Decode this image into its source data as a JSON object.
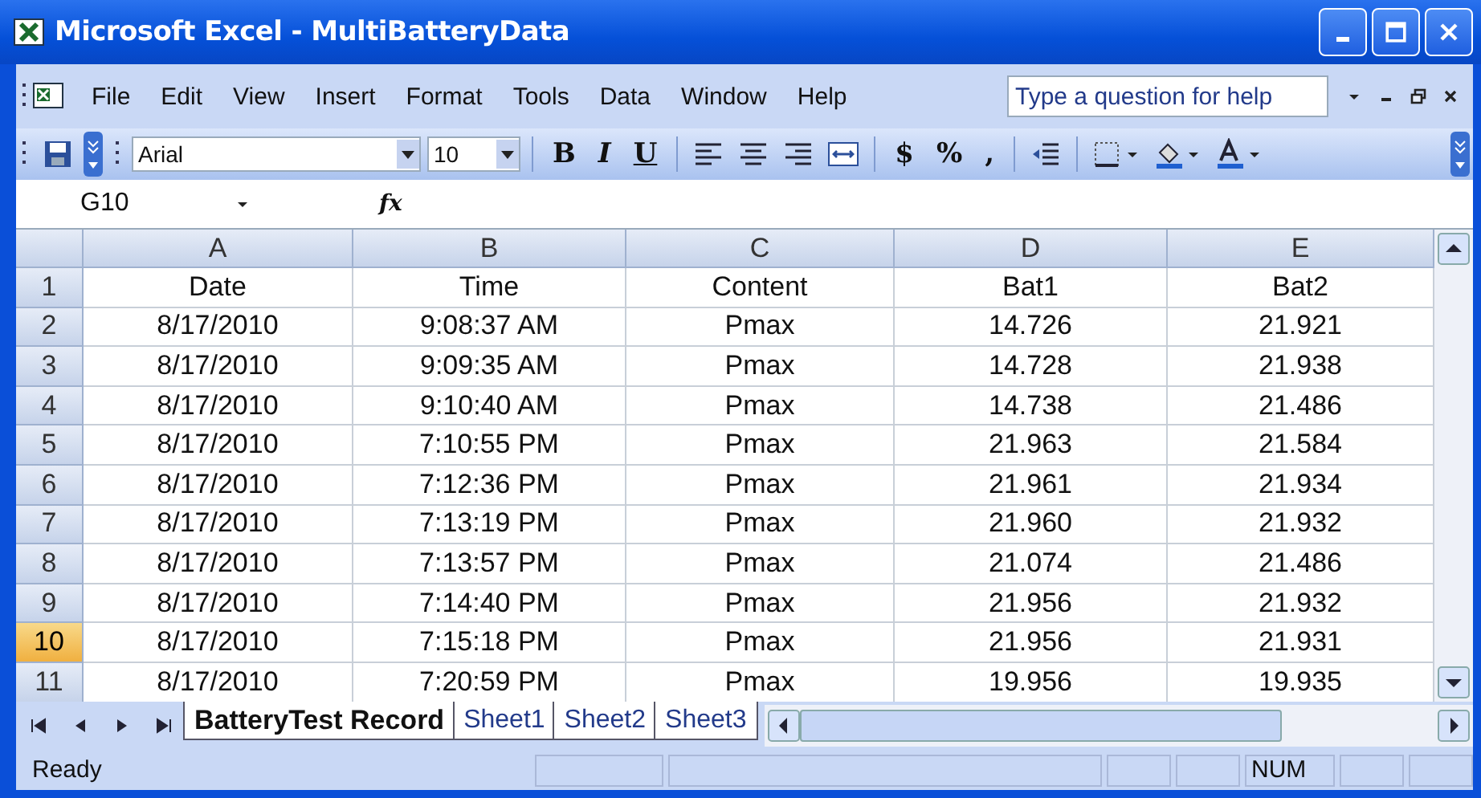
{
  "window": {
    "title": "Microsoft Excel - MultiBatteryData"
  },
  "menu": [
    "File",
    "Edit",
    "View",
    "Insert",
    "Format",
    "Tools",
    "Data",
    "Window",
    "Help"
  ],
  "help_search": {
    "placeholder": "Type a question for help"
  },
  "toolbar": {
    "font": "Arial",
    "size": "10",
    "bold": "B",
    "italic": "I",
    "underline": "U",
    "currency": "$",
    "percent": "%",
    "comma": ","
  },
  "formula_bar": {
    "name_box": "G10",
    "fx": "fx"
  },
  "columns": [
    "A",
    "B",
    "C",
    "D",
    "E"
  ],
  "rows": [
    {
      "header": "1",
      "selected": false,
      "cells": [
        "Date",
        "Time",
        "Content",
        "Bat1",
        "Bat2"
      ]
    },
    {
      "header": "2",
      "selected": false,
      "cells": [
        "8/17/2010",
        "9:08:37 AM",
        "Pmax",
        "14.726",
        "21.921"
      ]
    },
    {
      "header": "3",
      "selected": false,
      "cells": [
        "8/17/2010",
        "9:09:35 AM",
        "Pmax",
        "14.728",
        "21.938"
      ]
    },
    {
      "header": "4",
      "selected": false,
      "cells": [
        "8/17/2010",
        "9:10:40 AM",
        "Pmax",
        "14.738",
        "21.486"
      ]
    },
    {
      "header": "5",
      "selected": false,
      "cells": [
        "8/17/2010",
        "7:10:55 PM",
        "Pmax",
        "21.963",
        "21.584"
      ]
    },
    {
      "header": "6",
      "selected": false,
      "cells": [
        "8/17/2010",
        "7:12:36 PM",
        "Pmax",
        "21.961",
        "21.934"
      ]
    },
    {
      "header": "7",
      "selected": false,
      "cells": [
        "8/17/2010",
        "7:13:19 PM",
        "Pmax",
        "21.960",
        "21.932"
      ]
    },
    {
      "header": "8",
      "selected": false,
      "cells": [
        "8/17/2010",
        "7:13:57 PM",
        "Pmax",
        "21.074",
        "21.486"
      ]
    },
    {
      "header": "9",
      "selected": false,
      "cells": [
        "8/17/2010",
        "7:14:40 PM",
        "Pmax",
        "21.956",
        "21.932"
      ]
    },
    {
      "header": "10",
      "selected": true,
      "cells": [
        "8/17/2010",
        "7:15:18 PM",
        "Pmax",
        "21.956",
        "21.931"
      ]
    },
    {
      "header": "11",
      "selected": false,
      "cells": [
        "8/17/2010",
        "7:20:59 PM",
        "Pmax",
        "19.956",
        "19.935"
      ]
    }
  ],
  "sheet_tabs": [
    {
      "label": "BatteryTest Record",
      "selected": true
    },
    {
      "label": "Sheet1",
      "selected": false
    },
    {
      "label": "Sheet2",
      "selected": false
    },
    {
      "label": "Sheet3",
      "selected": false
    }
  ],
  "status_bar": {
    "status": "Ready",
    "num_lock": "NUM"
  }
}
